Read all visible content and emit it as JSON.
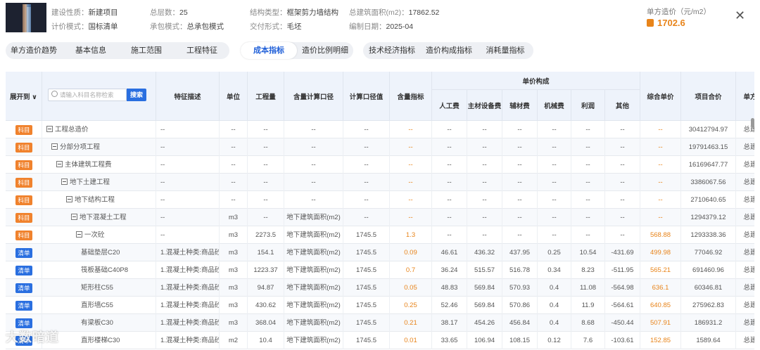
{
  "header": {
    "meta": [
      {
        "label": "建设性质：",
        "value": "新建项目"
      },
      {
        "label": "计价模式：",
        "value": "国标清单"
      },
      {
        "label": "总层数：",
        "value": "25"
      },
      {
        "label": "承包模式：",
        "value": "总承包模式"
      },
      {
        "label": "结构类型：",
        "value": "框架剪力墙结构"
      },
      {
        "label": "交付形式：",
        "value": "毛坯"
      },
      {
        "label": "总建筑面积(m2)：",
        "value": "17862.52"
      },
      {
        "label": "编制日期：",
        "value": "2025-04"
      }
    ],
    "price_label": "单方造价（元/m2）",
    "price_value": "1702.6",
    "close_glyph": "✕"
  },
  "tabs": {
    "group1": [
      "单方造价趋势",
      "基本信息",
      "施工范围",
      "工程特征"
    ],
    "group2": [
      "成本指标",
      "造价比例明细"
    ],
    "group3": [
      "技术经济指标",
      "造价构成指标",
      "消耗量指标"
    ],
    "active": "成本指标"
  },
  "table": {
    "expand_label": "展开到 ∨",
    "search_placeholder": "请输入科目名称检索",
    "search_button": "搜索",
    "headers": {
      "feature": "特征描述",
      "unit": "单位",
      "qty": "工程量",
      "content_basis": "含量计算口径",
      "calc_value": "计算口径值",
      "content_index": "含量指标",
      "unit_price_group": "单价构成",
      "labor": "人工费",
      "main_material": "主材设备费",
      "aux_material": "辅材费",
      "machine": "机械费",
      "profit": "利润",
      "other": "其他",
      "total_unit": "综合单价",
      "item_total": "项目合价",
      "unit_cost": "单方"
    },
    "rows": [
      {
        "badge": "科目",
        "kind": "ke",
        "indent": 0,
        "name": "工程总造价",
        "feature": "--",
        "unit": "--",
        "qty": "--",
        "basis": "--",
        "cv": "--",
        "ci": "--",
        "labor": "--",
        "main": "--",
        "aux": "--",
        "mach": "--",
        "profit": "--",
        "other": "--",
        "total": "--",
        "amount": "30412794.97",
        "tail": "总建"
      },
      {
        "badge": "科目",
        "kind": "ke",
        "indent": 1,
        "name": "分部分项工程",
        "feature": "--",
        "unit": "--",
        "qty": "--",
        "basis": "--",
        "cv": "--",
        "ci": "--",
        "labor": "--",
        "main": "--",
        "aux": "--",
        "mach": "--",
        "profit": "--",
        "other": "--",
        "total": "--",
        "amount": "19791463.15",
        "tail": "总建"
      },
      {
        "badge": "科目",
        "kind": "ke",
        "indent": 2,
        "name": "主体建筑工程费",
        "feature": "--",
        "unit": "--",
        "qty": "--",
        "basis": "--",
        "cv": "--",
        "ci": "--",
        "labor": "--",
        "main": "--",
        "aux": "--",
        "mach": "--",
        "profit": "--",
        "other": "--",
        "total": "--",
        "amount": "16169647.77",
        "tail": "总建"
      },
      {
        "badge": "科目",
        "kind": "ke",
        "indent": 3,
        "name": "地下土建工程",
        "feature": "--",
        "unit": "--",
        "qty": "--",
        "basis": "--",
        "cv": "--",
        "ci": "--",
        "labor": "--",
        "main": "--",
        "aux": "--",
        "mach": "--",
        "profit": "--",
        "other": "--",
        "total": "--",
        "amount": "3386067.56",
        "tail": "总建"
      },
      {
        "badge": "科目",
        "kind": "ke",
        "indent": 4,
        "name": "地下结构工程",
        "feature": "--",
        "unit": "--",
        "qty": "--",
        "basis": "--",
        "cv": "--",
        "ci": "--",
        "labor": "--",
        "main": "--",
        "aux": "--",
        "mach": "--",
        "profit": "--",
        "other": "--",
        "total": "--",
        "amount": "2710640.65",
        "tail": "总建"
      },
      {
        "badge": "科目",
        "kind": "ke",
        "indent": 5,
        "name": "地下混凝土工程",
        "feature": "--",
        "unit": "m3",
        "qty": "--",
        "basis": "地下建筑面积(m2)",
        "cv": "--",
        "ci": "--",
        "labor": "--",
        "main": "--",
        "aux": "--",
        "mach": "--",
        "profit": "--",
        "other": "--",
        "total": "--",
        "amount": "1294379.12",
        "tail": "总建"
      },
      {
        "badge": "科目",
        "kind": "ke",
        "indent": 6,
        "name": "一次砼",
        "feature": "--",
        "unit": "m3",
        "qty": "2273.5",
        "basis": "地下建筑面积(m2)",
        "cv": "1745.5",
        "ci": "1.3",
        "labor": "--",
        "main": "--",
        "aux": "--",
        "mach": "--",
        "profit": "--",
        "other": "--",
        "total": "568.88",
        "amount": "1293338.36",
        "tail": "总建"
      },
      {
        "badge": "清单",
        "kind": "qd",
        "indent": 7,
        "name": "基础垫层C20",
        "feature": "1.混凝土种类:商品砼...",
        "unit": "m3",
        "qty": "154.1",
        "basis": "地下建筑面积(m2)",
        "cv": "1745.5",
        "ci": "0.09",
        "labor": "46.61",
        "main": "436.32",
        "aux": "437.95",
        "mach": "0.25",
        "profit": "10.54",
        "other": "-431.69",
        "total": "499.98",
        "amount": "77046.92",
        "tail": "总建"
      },
      {
        "badge": "清单",
        "kind": "qd",
        "indent": 7,
        "name": "筏板基础C40P8",
        "feature": "1.混凝土种类:商品砼...",
        "unit": "m3",
        "qty": "1223.37",
        "basis": "地下建筑面积(m2)",
        "cv": "1745.5",
        "ci": "0.7",
        "labor": "36.24",
        "main": "515.57",
        "aux": "516.78",
        "mach": "0.34",
        "profit": "8.23",
        "other": "-511.95",
        "total": "565.21",
        "amount": "691460.96",
        "tail": "总建"
      },
      {
        "badge": "清单",
        "kind": "qd",
        "indent": 7,
        "name": "矩形柱C55",
        "feature": "1.混凝土种类:商品砼...",
        "unit": "m3",
        "qty": "94.87",
        "basis": "地下建筑面积(m2)",
        "cv": "1745.5",
        "ci": "0.05",
        "labor": "48.83",
        "main": "569.84",
        "aux": "570.93",
        "mach": "0.4",
        "profit": "11.08",
        "other": "-564.98",
        "total": "636.1",
        "amount": "60346.81",
        "tail": "总建"
      },
      {
        "badge": "清单",
        "kind": "qd",
        "indent": 7,
        "name": "直形墙C55",
        "feature": "1.混凝土种类:商品砼...",
        "unit": "m3",
        "qty": "430.62",
        "basis": "地下建筑面积(m2)",
        "cv": "1745.5",
        "ci": "0.25",
        "labor": "52.46",
        "main": "569.84",
        "aux": "570.86",
        "mach": "0.4",
        "profit": "11.9",
        "other": "-564.61",
        "total": "640.85",
        "amount": "275962.83",
        "tail": "总建"
      },
      {
        "badge": "清单",
        "kind": "qd",
        "indent": 7,
        "name": "有梁板C30",
        "feature": "1.混凝土种类:商品砼...",
        "unit": "m3",
        "qty": "368.04",
        "basis": "地下建筑面积(m2)",
        "cv": "1745.5",
        "ci": "0.21",
        "labor": "38.17",
        "main": "454.26",
        "aux": "456.84",
        "mach": "0.4",
        "profit": "8.68",
        "other": "-450.44",
        "total": "507.91",
        "amount": "186931.2",
        "tail": "总建"
      },
      {
        "badge": "清单",
        "kind": "qd",
        "indent": 7,
        "name": "直形楼梯C30",
        "feature": "1.混凝土种类:商品砼...",
        "unit": "m2",
        "qty": "10.4",
        "basis": "地下建筑面积(m2)",
        "cv": "1745.5",
        "ci": "0.01",
        "labor": "33.65",
        "main": "106.94",
        "aux": "108.15",
        "mach": "0.12",
        "profit": "7.6",
        "other": "-103.61",
        "total": "152.85",
        "amount": "1589.64",
        "tail": "总建"
      }
    ]
  },
  "watermark": "大数暗道"
}
